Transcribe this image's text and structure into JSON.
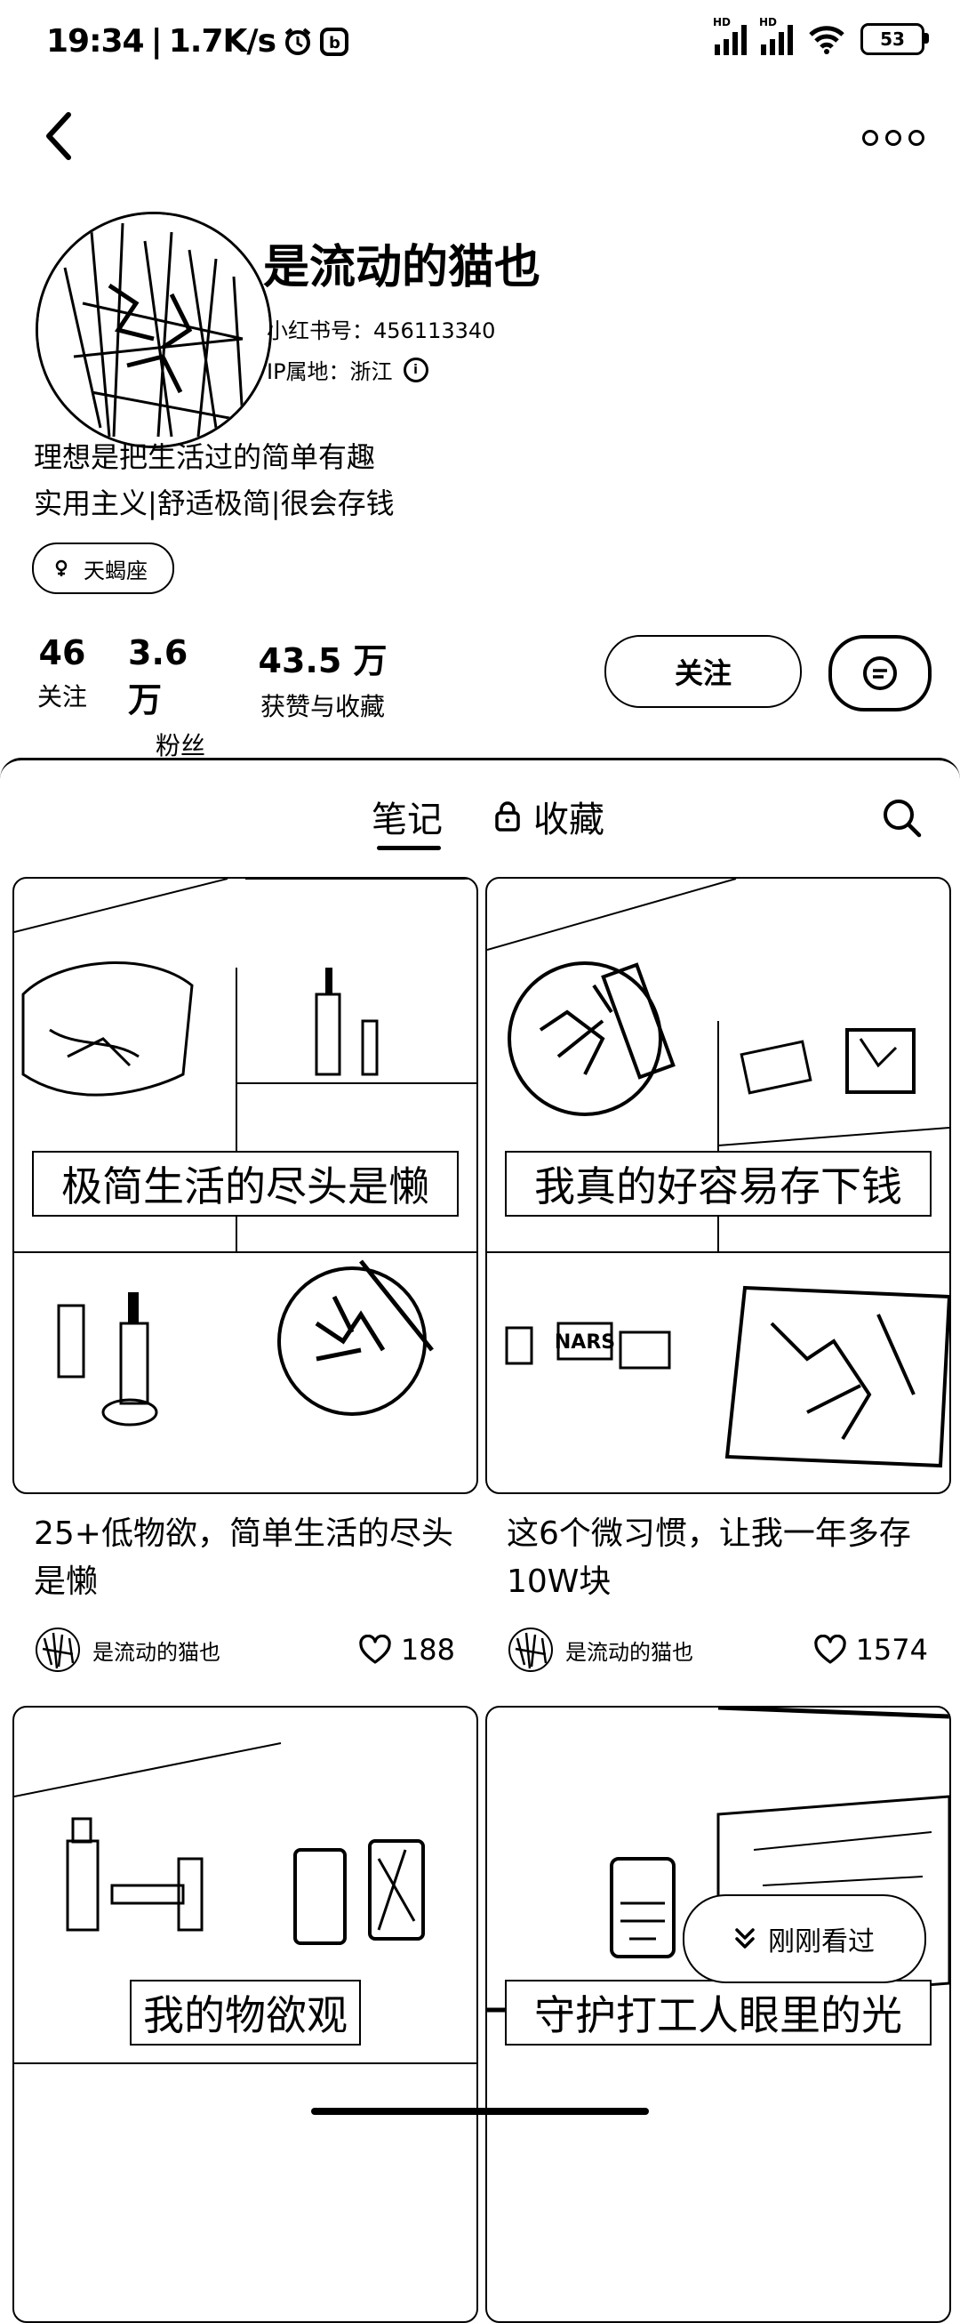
{
  "status_bar": {
    "time": "19:34",
    "speed": "1.7K/s",
    "battery": "53"
  },
  "profile": {
    "name": "是流动的猫也",
    "id_label": "小红书号：456113340",
    "ip_label": "IP属地：浙江",
    "bio_lines": [
      "理想是把生活过的简单有趣",
      "实用主义|舒适极简|很会存钱"
    ],
    "tag": "天蝎座"
  },
  "stats": [
    {
      "value": "46",
      "label": "关注"
    },
    {
      "value": "3.6 万",
      "label": "粉丝"
    },
    {
      "value": "43.5 万",
      "label": "获赞与收藏"
    }
  ],
  "actions": {
    "follow_label": "关注"
  },
  "tabs": {
    "notes": "笔记",
    "collections": "收藏"
  },
  "cards": [
    {
      "caption_top": "极简生活的尽头是懒",
      "title": "25+低物欲，简单生活的尽头是懒",
      "author": "是流动的猫也",
      "likes": "188"
    },
    {
      "caption_top": "我真的好容易存下钱",
      "title": "这6个微习惯，让我一年多存10W块",
      "author": "是流动的猫也",
      "likes": "1574"
    },
    {
      "caption_top": "我的物欲观"
    },
    {
      "caption_top": "守护打工人眼里的光"
    }
  ],
  "floating": {
    "recent_label": "刚刚看过"
  }
}
